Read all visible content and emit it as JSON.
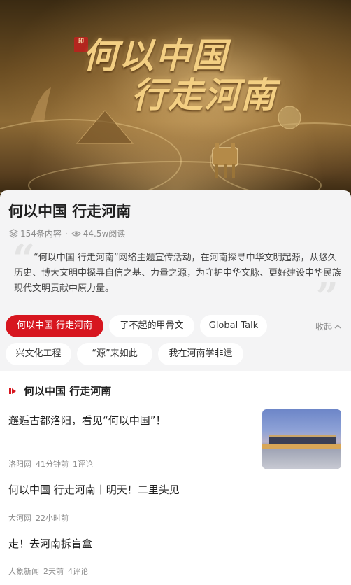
{
  "banner": {
    "seal_text": "印",
    "line1": "何以中国",
    "line2": "行走河南"
  },
  "topic": {
    "title": "何以中国 行走河南",
    "content_count": "154条内容",
    "separator": "·",
    "read_count": "44.5w阅读",
    "quote_open": "“",
    "quote_close": "”",
    "description": "“何以中国 行走河南”网络主题宣传活动，在河南探寻中华文明起源，从悠久历史、博大文明中探寻自信之基、力量之源，为守护中华文脉、更好建设中华民族现代文明贡献中原力量。"
  },
  "chips": [
    {
      "label": "何以中国 行走河南",
      "active": true
    },
    {
      "label": "了不起的甲骨文",
      "active": false
    },
    {
      "label": "Global Talk",
      "active": false
    },
    {
      "label": "兴文化工程",
      "active": false
    },
    {
      "label": "“源”来如此",
      "active": false
    },
    {
      "label": "我在河南学非遗",
      "active": false
    }
  ],
  "collapse_label": "收起",
  "feed": {
    "section_title": "何以中国 行走河南",
    "items": [
      {
        "title": "邂逅古都洛阳，看见“何以中国”！",
        "source": "洛阳网",
        "time": "41分钟前",
        "comments": "1评论"
      },
      {
        "title": "何以中国 行走河南丨明天！二里头见",
        "source": "大河网",
        "time": "22小时前",
        "comments": ""
      },
      {
        "title": "走！去河南拆盲盒",
        "source": "大象新闻",
        "time": "2天前",
        "comments": "4评论"
      }
    ]
  },
  "colors": {
    "accent": "#d7161f",
    "gold": "#f3cf83"
  }
}
